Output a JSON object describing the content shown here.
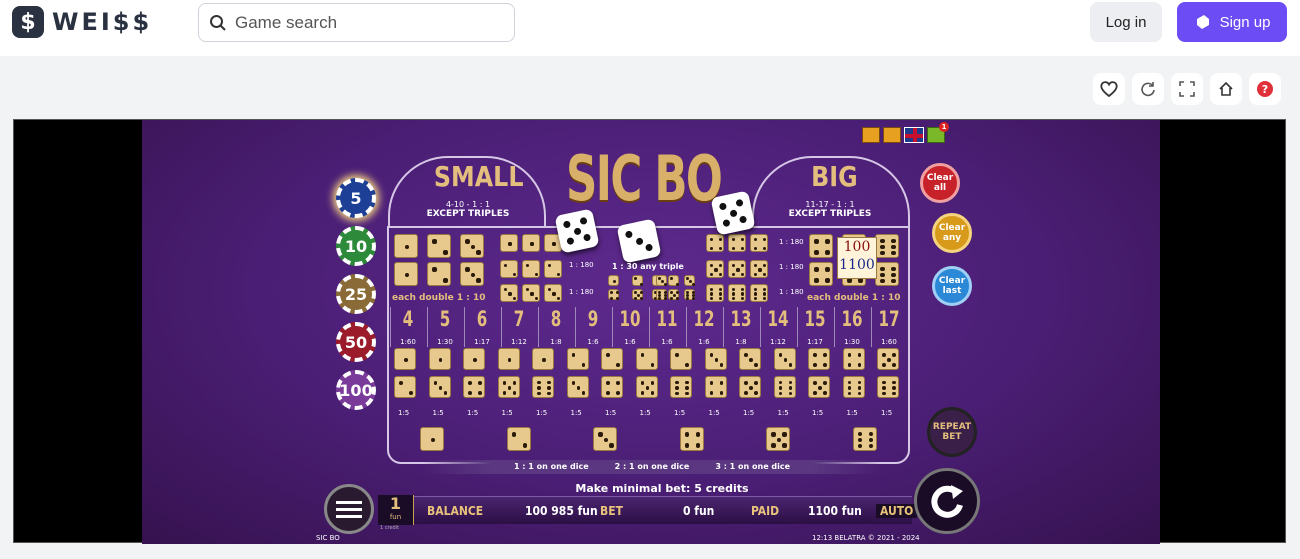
{
  "site": {
    "logo_glyph": "$",
    "logo_text": "WEI$$",
    "search_placeholder": "Game search",
    "login": "Log in",
    "signup": "Sign up"
  },
  "toolbar_icons": [
    "heart-icon",
    "refresh-icon",
    "fullscreen-icon",
    "home-icon",
    "help-icon"
  ],
  "game": {
    "title": "SIC BO",
    "small": {
      "label": "SMALL",
      "odds": "4-10 - 1 : 1",
      "note": "EXCEPT TRIPLES"
    },
    "big": {
      "label": "BIG",
      "odds": "11-17 - 1 : 1",
      "note": "EXCEPT TRIPLES"
    },
    "each_double": "each double 1 : 10",
    "triple_any": "1 : 30 any triple",
    "triple_odds": "1 : 180",
    "totals": [
      {
        "n": "4",
        "o": "1:60"
      },
      {
        "n": "5",
        "o": "1:30"
      },
      {
        "n": "6",
        "o": "1:17"
      },
      {
        "n": "7",
        "o": "1:12"
      },
      {
        "n": "8",
        "o": "1:8"
      },
      {
        "n": "9",
        "o": "1:6"
      },
      {
        "n": "10",
        "o": "1:6"
      },
      {
        "n": "11",
        "o": "1:6"
      },
      {
        "n": "12",
        "o": "1:6"
      },
      {
        "n": "13",
        "o": "1:8"
      },
      {
        "n": "14",
        "o": "1:12"
      },
      {
        "n": "15",
        "o": "1:17"
      },
      {
        "n": "16",
        "o": "1:30"
      },
      {
        "n": "17",
        "o": "1:60"
      }
    ],
    "pair_odds": "1:5",
    "single_odds": [
      "1 : 1 on one dice",
      "2 : 1 on one dice",
      "3 : 1 on one dice"
    ],
    "bet_box": {
      "top": "100",
      "bottom": "1100"
    },
    "chips": [
      "5",
      "10",
      "25",
      "50",
      "100"
    ],
    "buttons": {
      "clear_all": "Clear all",
      "clear_any": "Clear any",
      "clear_last": "Clear last",
      "repeat": "REPEAT BET",
      "auto": "AUTO"
    },
    "message": "Make minimal bet: 5 credits",
    "coin": {
      "value": "1",
      "unit": "fun",
      "sub": "1 credit"
    },
    "balance_label": "BALANCE",
    "balance": "100 985 fun",
    "bet_label": "BET",
    "bet": "0 fun",
    "paid_label": "PAID",
    "paid": "1100 fun",
    "footer_left": "SIC BO",
    "footer_right": "12:13  BELATRA © 2021 - 2024",
    "badge": "1",
    "colors": {
      "chip5": "#1d3f96",
      "chip10": "#2d8a3a",
      "chip25": "#8a6a36",
      "chip50": "#9b1b2a",
      "chip100": "#7a3a9a",
      "clear_all": "#c7222a",
      "clear_any": "#d89a1a",
      "clear_last": "#2a88d6"
    }
  }
}
